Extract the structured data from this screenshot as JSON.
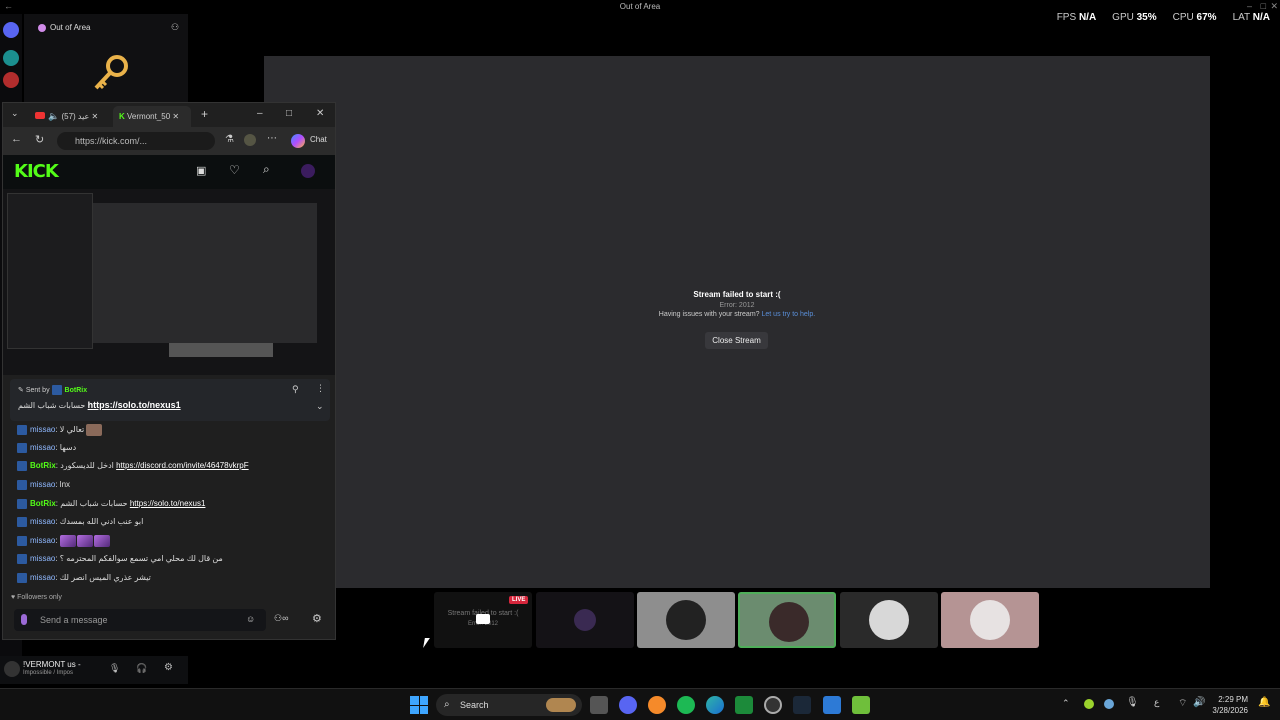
{
  "window": {
    "title": "Out of Area"
  },
  "perf": {
    "fps_label": "FPS",
    "fps_value": "N/A",
    "gpu_label": "GPU",
    "gpu_value": "35%",
    "cpu_label": "CPU",
    "cpu_value": "67%",
    "lat_label": "LAT",
    "lat_value": "N/A"
  },
  "sidebar": {
    "server_name": "Out of Area",
    "user_name": "!VERMONT us -",
    "user_status": "Impossible / Impos"
  },
  "stage": {
    "error_title": "Stream failed to start :(",
    "error_code": "Error: 2012",
    "question": "Having issues with your stream?",
    "help_link": "Let us try to help.",
    "close_button": "Close Stream"
  },
  "thumbs": {
    "live_badge": "LIVE",
    "first_text": "Stream failed to start :(",
    "first_sub": "Error: 2012"
  },
  "browser": {
    "tab1_label": "(57) عيد",
    "tab2_label": "Vermont_50",
    "url": "https://kick.com/...",
    "chat_label": "Chat"
  },
  "kick": {
    "logo": "KICK",
    "pinned_sent_by": "Sent by",
    "pinned_user": "BotRix",
    "pinned_text": "حسابات شباب الشم",
    "pinned_link": "https://solo.to/nexus1",
    "followers_only": "Followers only",
    "input_placeholder": "Send a message",
    "messages": [
      {
        "user": "missao",
        "text": "تعالي لا"
      },
      {
        "user": "missao",
        "text": "دسها"
      },
      {
        "user": "BotRix",
        "text": "ادخل للديسكورد",
        "link": "https://discord.com/invite/46478vkrpF"
      },
      {
        "user": "missao",
        "text": "lnx"
      },
      {
        "user": "BotRix",
        "text": "حسابات شباب الشم",
        "link": "https://solo.to/nexus1"
      },
      {
        "user": "missao",
        "text": "ابو عنب ادني الله بمسدك"
      },
      {
        "user": "missao",
        "text": ""
      },
      {
        "user": "missao",
        "text": "من قال لك محلي امي تسمع سوالفكم المحترمه ؟"
      },
      {
        "user": "missao",
        "text": "تيشر عذري الميس انصر لك"
      }
    ]
  },
  "taskbar": {
    "search_label": "Search",
    "time": "2:29 PM",
    "date": "3/28/2026"
  }
}
